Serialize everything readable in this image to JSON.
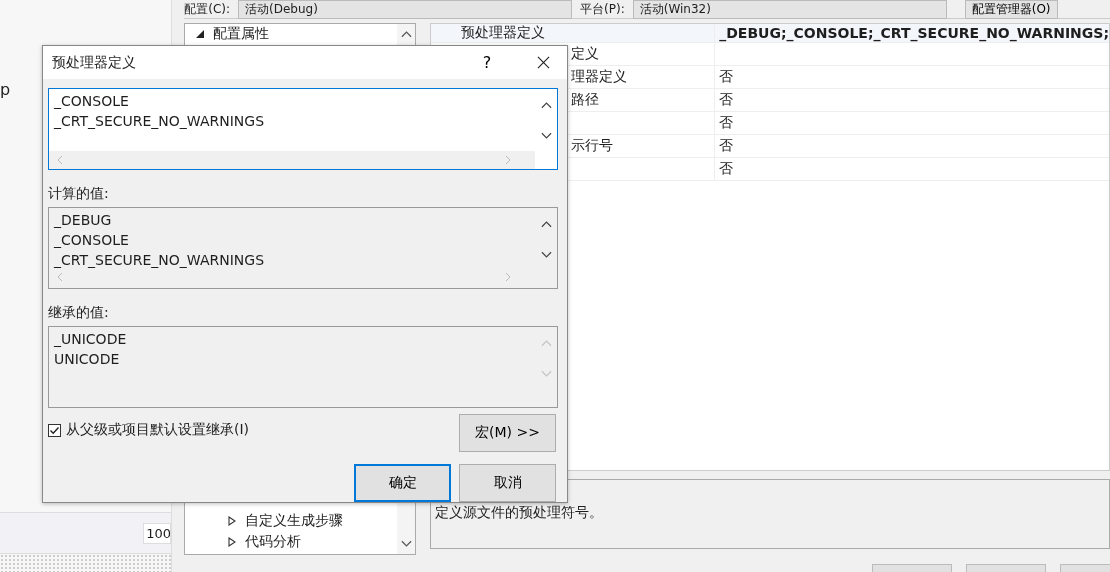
{
  "left_pane": {
    "text": "p",
    "zoom_field": "100"
  },
  "property_pages": {
    "configuration_label": "配置(C):",
    "configuration_value": "活动(Debug)",
    "platform_label": "平台(P):",
    "platform_value": "活动(Win32)",
    "manager_button": "配置管理器(O)",
    "tree": {
      "items": [
        {
          "label": "配置属性",
          "expanded": true
        },
        {
          "label": "自定义生成步骤",
          "expanded": false
        },
        {
          "label": "代码分析",
          "expanded": false
        }
      ]
    },
    "grid": {
      "rows": [
        {
          "name": "预处理器定义",
          "value": "_DEBUG;_CONSOLE;_CRT_SECURE_NO_WARNINGS;",
          "selected": true
        },
        {
          "name": "定义",
          "selected": false
        },
        {
          "name": "理器定义",
          "value": "否",
          "selected": false
        },
        {
          "name": "路径",
          "value": "否",
          "selected": false
        },
        {
          "value": "否",
          "selected": false
        },
        {
          "name": "示行号",
          "value": "否",
          "selected": false
        },
        {
          "value": "否",
          "selected": false
        }
      ]
    },
    "description": "定义源文件的预处理符号。"
  },
  "dialog": {
    "title": "预处理器定义",
    "help": "?",
    "edit_lines": [
      "_CONSOLE",
      "_CRT_SECURE_NO_WARNINGS"
    ],
    "evaluated_label": "计算的值:",
    "evaluated_lines": [
      "_DEBUG",
      "_CONSOLE",
      "_CRT_SECURE_NO_WARNINGS"
    ],
    "inherited_label": "继承的值:",
    "inherited_lines": [
      "_UNICODE",
      "UNICODE"
    ],
    "inherit": {
      "label": "从父级或项目默认设置继承(I)",
      "checked": true
    },
    "macros_button": "宏(M) >>",
    "ok_button": "确定",
    "cancel_button": "取消"
  }
}
